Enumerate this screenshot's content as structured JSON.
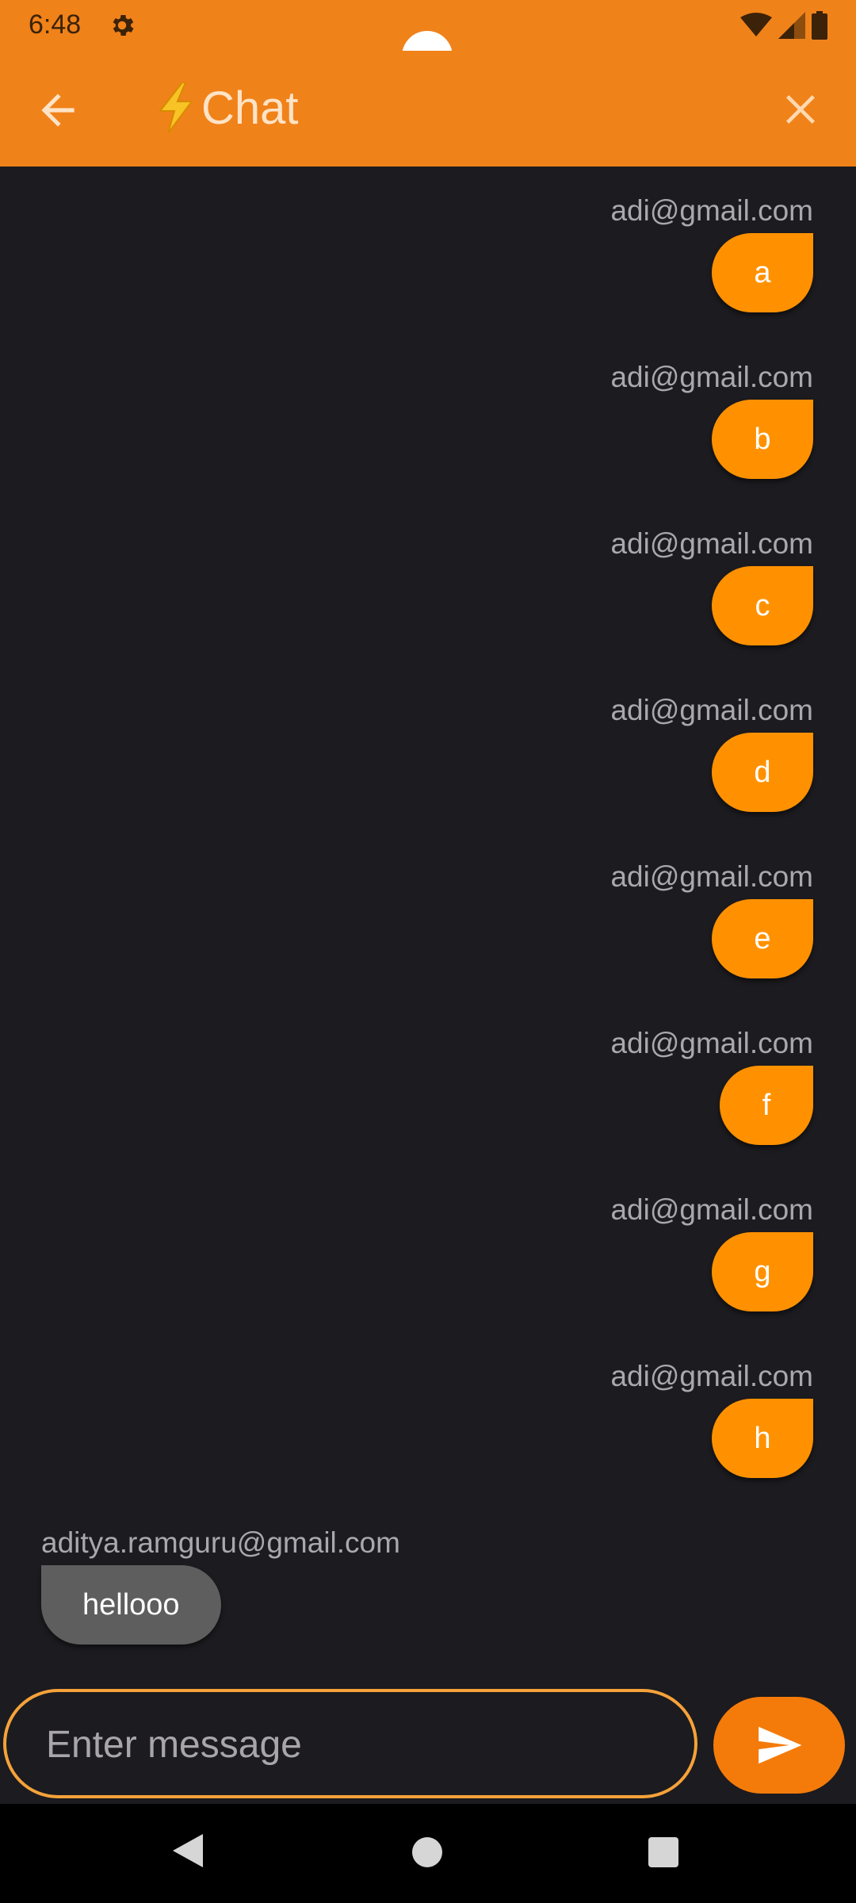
{
  "status_bar": {
    "time": "6:48"
  },
  "app_bar": {
    "title": "Chat"
  },
  "messages": [
    {
      "sender": "adi@gmail.com",
      "text": "a"
    },
    {
      "sender": "adi@gmail.com",
      "text": "b"
    },
    {
      "sender": "adi@gmail.com",
      "text": "c"
    },
    {
      "sender": "adi@gmail.com",
      "text": "d"
    },
    {
      "sender": "adi@gmail.com",
      "text": "e"
    },
    {
      "sender": "adi@gmail.com",
      "text": "f"
    },
    {
      "sender": "adi@gmail.com",
      "text": "g"
    },
    {
      "sender": "adi@gmail.com",
      "text": "h"
    },
    {
      "sender": "aditya.ramguru@gmail.com",
      "text": "hellooo"
    }
  ],
  "composer": {
    "placeholder": "Enter message",
    "value": ""
  },
  "colors": {
    "accent": "#f0821a",
    "outgoing_bubble": "#ff9100",
    "incoming_bubble": "#5e5e5e",
    "background": "#1c1b1f"
  }
}
